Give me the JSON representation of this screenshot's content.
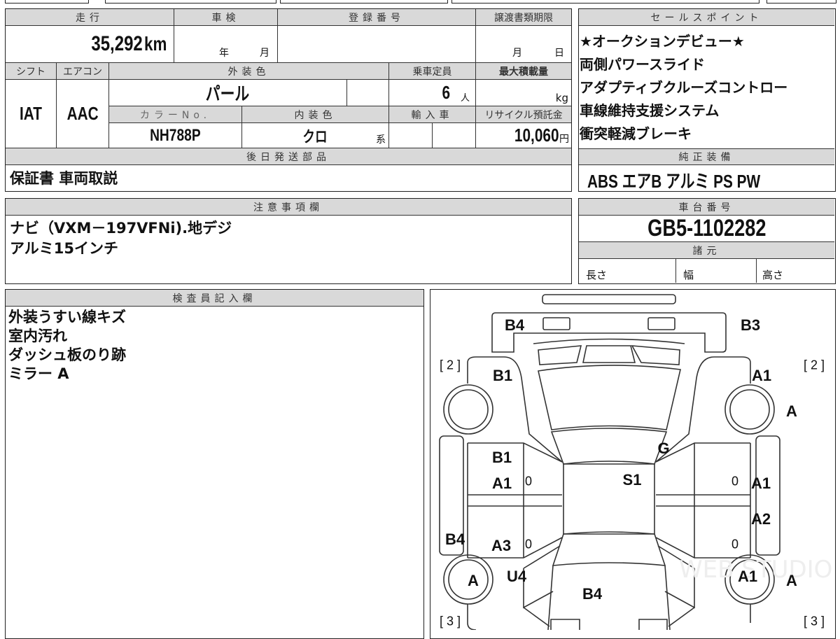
{
  "headers": {
    "mileage": "走行",
    "inspection": "車検",
    "registration": "登録番号",
    "transfer_deadline": "譲渡書類期限",
    "shift": "シフト",
    "aircon": "エアコン",
    "exterior_color": "外装色",
    "capacity": "乗車定員",
    "max_load": "最大積載量",
    "color_no": "カラーNo.",
    "interior_color": "内装色",
    "import": "輸入車",
    "recycle": "リサイクル預託金",
    "later_parts": "後日発送部品",
    "sales_points": "セールスポイント",
    "equipment": "純正装備",
    "notes": "注意事項欄",
    "chassis": "車台番号",
    "specs": "諸元",
    "inspector": "検査員記入欄"
  },
  "values": {
    "mileage": "35,292",
    "mileage_unit": "km",
    "year_unit": "年",
    "month_unit": "月",
    "day_unit": "日",
    "shift": "IAT",
    "aircon": "AAC",
    "exterior_color": "パール",
    "capacity": "6",
    "capacity_unit": "人",
    "load_unit": "kg",
    "color_no": "NH788P",
    "interior_color": "クロ",
    "interior_suffix": "系",
    "recycle": "10,060",
    "recycle_unit": "円",
    "later_parts": "保証書 車両取説",
    "equipment": "ABS エアB アルミ PS PW",
    "chassis": "GB5-1102282"
  },
  "sales_points": [
    "★オークションデビュー★",
    "両側パワースライド",
    "アダプティブクルーズコントロー",
    "車線維持支援システム",
    "衝突軽減ブレーキ"
  ],
  "notes": [
    "ナビ（VXM－197VFNi).地デジ",
    "アルミ15インチ"
  ],
  "specs": {
    "length": "長さ",
    "width": "幅",
    "height": "高さ"
  },
  "inspector_notes": [
    "外装うすい線キズ",
    "室内汚れ",
    "ダッシュ板のり跡",
    "ミラー A"
  ],
  "diagram": {
    "marks": [
      "B4",
      "B3",
      "[ 2 ]",
      "B1",
      "A1",
      "[ 2 ]",
      "A",
      "G",
      "B1",
      "A1",
      "0",
      "S1",
      "0",
      "A1",
      "A2",
      "B4",
      "A3",
      "0",
      "0",
      "U4",
      "A",
      "A1",
      "A",
      "B4",
      "[ 3 ]",
      "[ 3 ]"
    ]
  }
}
